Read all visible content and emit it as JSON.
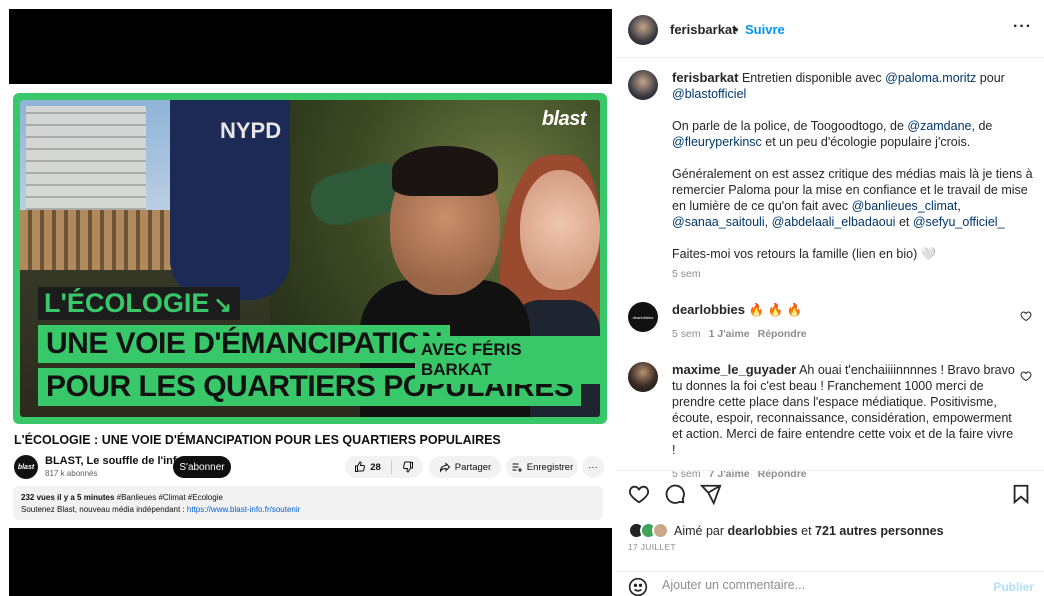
{
  "video": {
    "brand": "blast",
    "headline_line1": "L'ÉCOLOGIE",
    "headline_arrow": "↘",
    "headline_line2": "UNE VOIE D'ÉMANCIPATION",
    "headline_line3": "POUR LES QUARTIERS POPULAIRES",
    "guest_tag": "AVEC FÉRIS BARKAT",
    "shirt_text": "NYPD",
    "title": "L'ÉCOLOGIE : UNE VOIE D'ÉMANCIPATION POUR LES QUARTIERS POPULAIRES",
    "channel_avatar_text": "blast",
    "channel_name": "BLAST, Le souffle de l'info",
    "channel_subs": "817 k abonnés",
    "subscribe_label": "S'abonner",
    "like_count": "28",
    "share_label": "Partager",
    "save_label": "Enregistrer",
    "more_label": "···",
    "desc_views": "232 vues",
    "desc_time": "il y a 5 minutes",
    "desc_tags": "#Banlieues #Climat #Ecologie",
    "desc_line2": "Soutenez Blast, nouveau média indépendant : ",
    "desc_link": "https://www.blast-info.fr/soutenir"
  },
  "post": {
    "username": "ferisbarkat",
    "separator": "•",
    "follow_label": "Suivre",
    "more_label": "···",
    "caption": {
      "p1_text": "Entretien disponible avec ",
      "p1_mention1": "@paloma.moritz",
      "p1_mid": " pour ",
      "p1_mention2": "@blastofficiel",
      "p2_a": "On parle de la police, de Toogoodtogo, de ",
      "p2_mention1": "@zamdane",
      "p2_b": ", de ",
      "p2_mention2": "@fleuryperkinsc",
      "p2_c": " et un peu d'écologie populaire j'crois.",
      "p3_a": "Généralement on est assez critique des médias mais là je tiens à remercier Paloma pour la mise en confiance et le travail de mise en lumière de ce qu'on fait avec ",
      "p3_mention1": "@banlieues_climat",
      "p3_b": ", ",
      "p3_mention2": "@sanaa_saitouli",
      "p3_c": ", ",
      "p3_mention3": "@abdelaali_elbadaoui",
      "p3_d": " et ",
      "p3_mention4": "@sefyu_officiel_",
      "p4": "Faites-moi vos retours la famille (lien en bio) 🤍",
      "time": "5 sem"
    },
    "comments": [
      {
        "username": "dearlobbies",
        "avatar_text": "dearlobbies",
        "text": "🔥 🔥 🔥",
        "time": "5 sem",
        "likes": "1 J'aime",
        "reply": "Répondre"
      },
      {
        "username": "maxime_le_guyader",
        "text": "Ah ouai t'enchaiiiinnnnes ! Bravo bravo tu donnes la foi c'est beau ! Franchement 1000 merci de prendre cette place dans l'espace médiatique. Positivisme, écoute, espoir, reconnaissance, considération, empowerment et action. Merci de faire entendre cette voix et de la faire vivre !",
        "time": "5 sem",
        "likes": "7 J'aime",
        "reply": "Répondre"
      }
    ],
    "liked_prefix": "Aimé par ",
    "liked_user": "dearlobbies",
    "liked_mid": " et ",
    "liked_count": "721 autres personnes",
    "date": "17 JUILLET",
    "comment_placeholder": "Ajouter un commentaire...",
    "publish_label": "Publier"
  }
}
